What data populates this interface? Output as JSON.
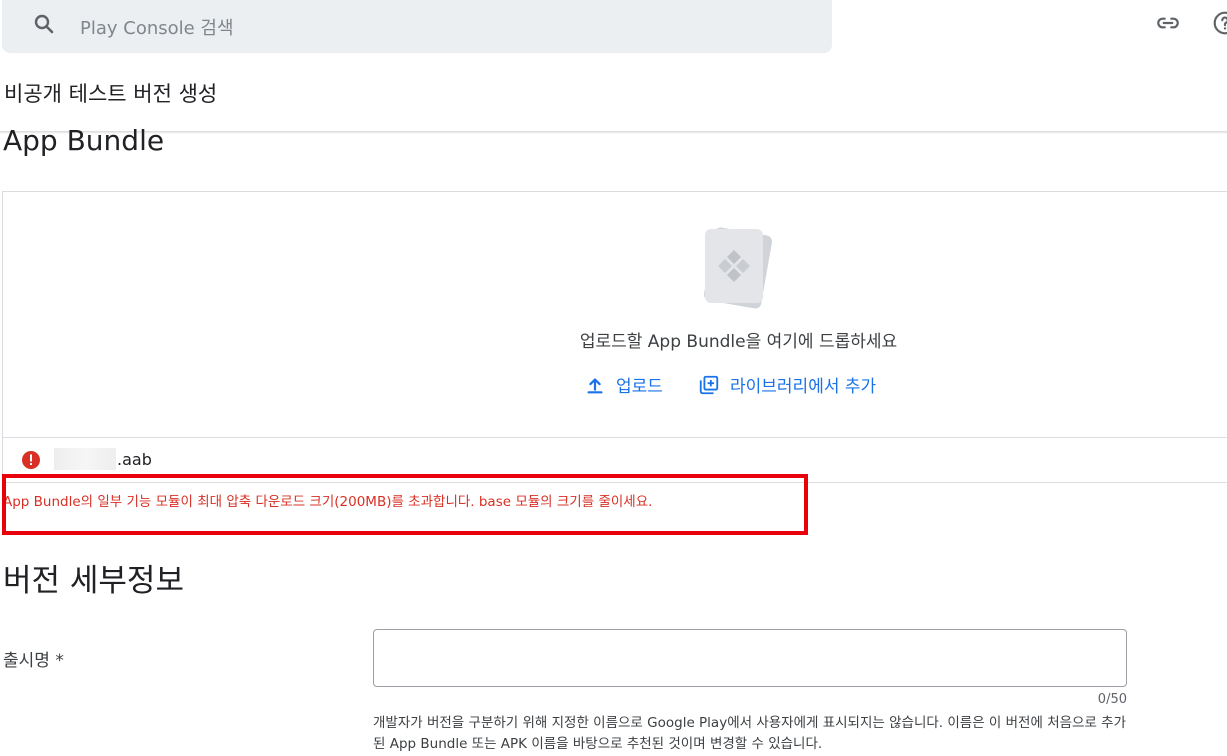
{
  "search": {
    "placeholder": "Play Console 검색"
  },
  "header": {
    "title": "비공개 테스트 버전 생성"
  },
  "app_bundle": {
    "section_title": "App Bundle",
    "drop_hint": "업로드할 App Bundle을 여기에 드롭하세요",
    "upload_label": "업로드",
    "library_label": "라이브러리에서 추가",
    "file_extension": ".aab",
    "error_message": "App Bundle의 일부 기능 모듈이 최대 압축 다운로드 크기(200MB)를 초과합니다. base 모듈의 크기를 줄이세요."
  },
  "release_details": {
    "title": "버전 세부정보",
    "name_label": "출시명 *",
    "name_value": "",
    "char_count": "0/50",
    "helper": "개발자가 버전을 구분하기 위해 지정한 이름으로 Google Play에서 사용자에게 표시되지는 않습니다. 이름은 이 버전에 처음으로 추가된 App Bundle 또는 APK 이름을 바탕으로 추천된 것이며 변경할 수 있습니다."
  },
  "colors": {
    "accent": "#1a73e8",
    "error": "#d93025",
    "highlight": "#e8000a"
  }
}
